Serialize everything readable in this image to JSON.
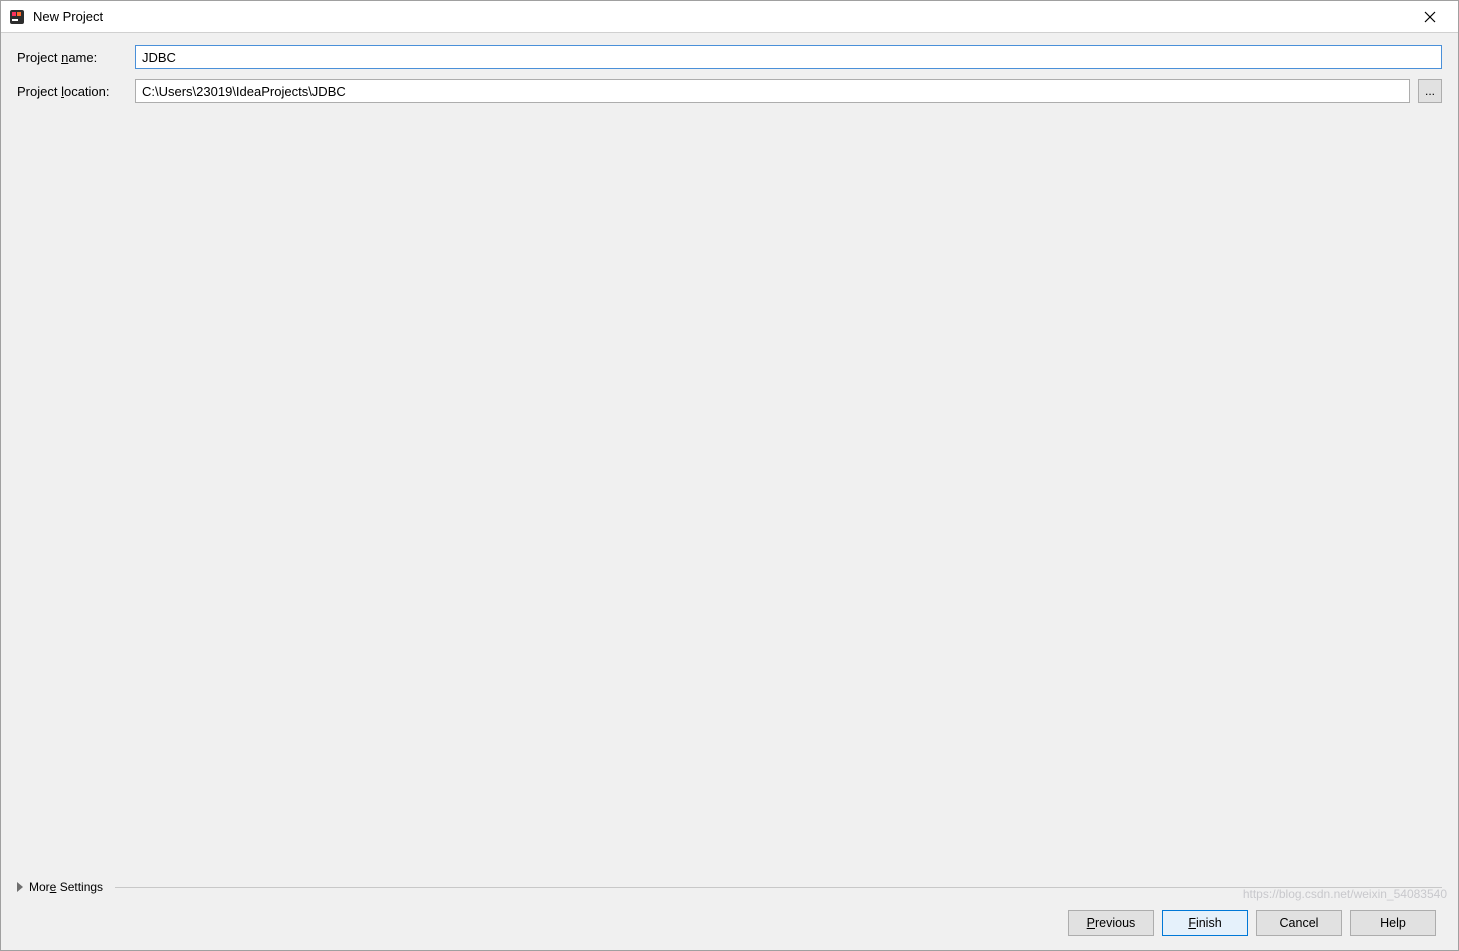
{
  "window": {
    "title": "New Project"
  },
  "form": {
    "project_name_label": "Project name:",
    "project_name_value": "JDBC",
    "project_location_label": "Project location:",
    "project_location_value": "C:\\Users\\23019\\IdeaProjects\\JDBC",
    "browse_label": "..."
  },
  "more_settings": {
    "label": "More Settings"
  },
  "buttons": {
    "previous": "Previous",
    "finish": "Finish",
    "cancel": "Cancel",
    "help": "Help"
  },
  "watermark": "https://blog.csdn.net/weixin_54083540"
}
